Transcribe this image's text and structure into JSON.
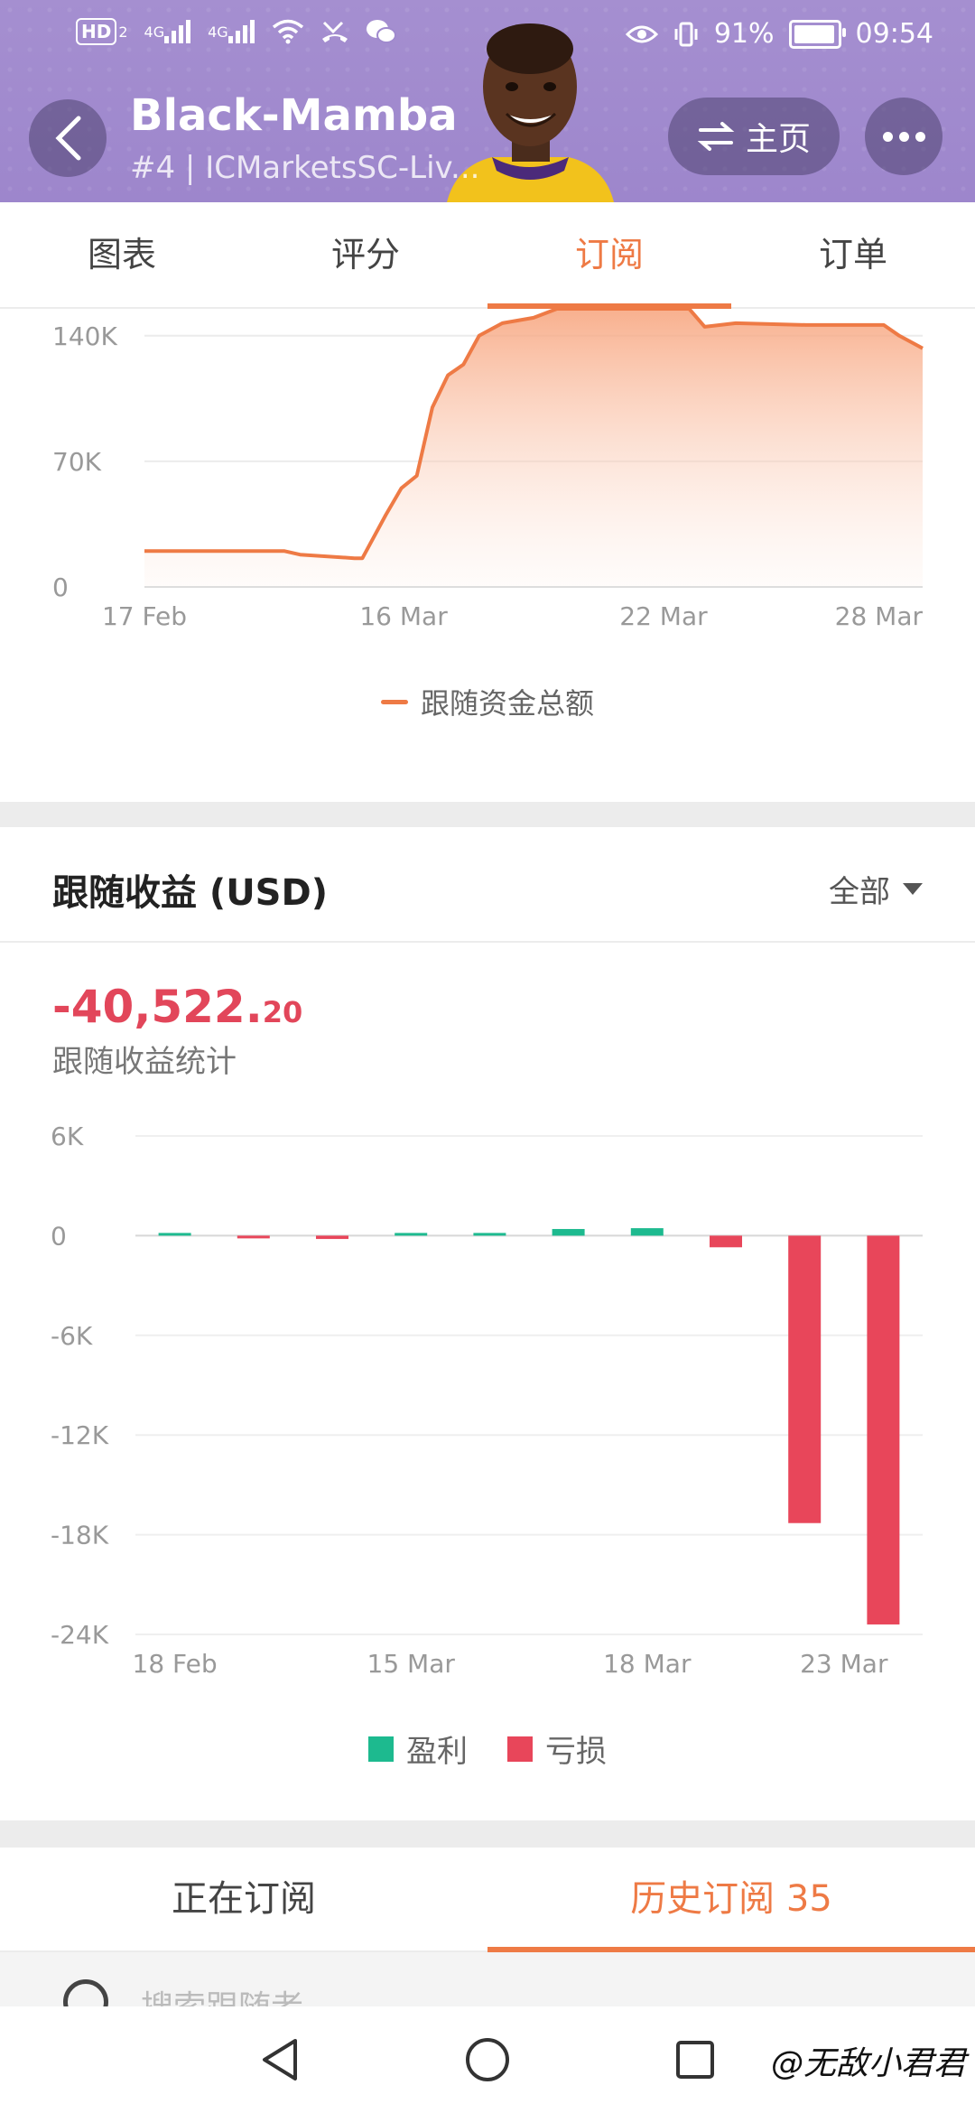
{
  "status_bar": {
    "hd_label": "HD",
    "sim_label": "2",
    "signal1": "4G",
    "signal2": "4G",
    "battery": "91%",
    "time": "09:54"
  },
  "header": {
    "title": "Black-Mamba",
    "subtitle": "#4 | ICMarketsSC-Liv...",
    "home_label": "主页"
  },
  "tabs": [
    {
      "label": "图表",
      "active": false
    },
    {
      "label": "评分",
      "active": false
    },
    {
      "label": "订阅",
      "active": true
    },
    {
      "label": "订单",
      "active": false
    }
  ],
  "chart_data": [
    {
      "type": "area",
      "yticks": [
        "140K",
        "70K",
        "0"
      ],
      "xticks": [
        "17 Feb",
        "16 Mar",
        "22 Mar",
        "28 Mar"
      ],
      "ylim": [
        0,
        155000
      ],
      "series": [
        {
          "name": "跟随资金总额",
          "color": "#ee7a45",
          "points": [
            [
              0,
              20000
            ],
            [
              0.18,
              20000
            ],
            [
              0.2,
              18000
            ],
            [
              0.27,
              16000
            ],
            [
              0.28,
              16000
            ],
            [
              0.31,
              40000
            ],
            [
              0.33,
              55000
            ],
            [
              0.35,
              62000
            ],
            [
              0.37,
              100000
            ],
            [
              0.39,
              118000
            ],
            [
              0.41,
              124000
            ],
            [
              0.43,
              140000
            ],
            [
              0.46,
              147000
            ],
            [
              0.5,
              150000
            ],
            [
              0.53,
              155000
            ],
            [
              0.7,
              155000
            ],
            [
              0.72,
              145000
            ],
            [
              0.76,
              147000
            ],
            [
              0.85,
              146000
            ],
            [
              0.95,
              146000
            ],
            [
              0.97,
              140000
            ],
            [
              1.0,
              133000
            ]
          ]
        }
      ],
      "grid": true,
      "legend": "bottom-center"
    },
    {
      "type": "bar",
      "yticks": [
        "6K",
        "0",
        "-6K",
        "-12K",
        "-18K",
        "-24K"
      ],
      "xticks": [
        "18 Feb",
        "15 Mar",
        "18 Mar",
        "23 Mar"
      ],
      "ylim": [
        -24000,
        6000
      ],
      "values": [
        50,
        -80,
        -200,
        50,
        50,
        400,
        450,
        -700,
        -17300,
        -23400
      ],
      "series": [
        {
          "name": "盈利",
          "color": "#1dba8f"
        },
        {
          "name": "亏损",
          "color": "#e8465a"
        }
      ],
      "grid": true,
      "legend": "bottom-center"
    }
  ],
  "section2": {
    "title": "跟随收益 (USD)",
    "filter_label": "全部",
    "value_main": "-40,522.",
    "value_dec": "20",
    "caption": "跟随收益统计"
  },
  "sub_tabs": [
    {
      "label": "正在订阅",
      "active": false
    },
    {
      "label": "历史订阅 35",
      "active": true
    }
  ],
  "search": {
    "placeholder": "搜索跟随者"
  },
  "watermark": "@无敌小君君"
}
